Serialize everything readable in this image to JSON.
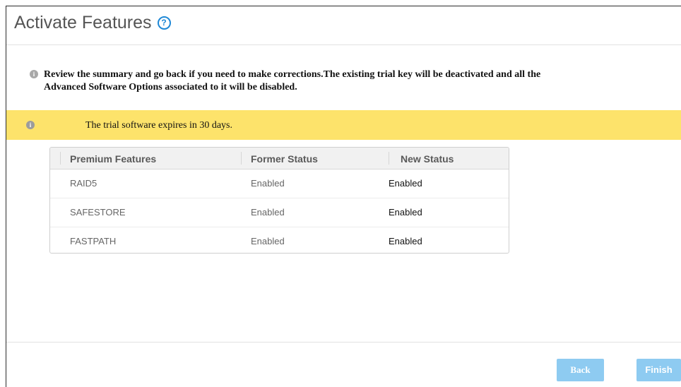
{
  "header": {
    "title": "Activate Features",
    "help_icon": "?"
  },
  "info_icon": "i",
  "review_message": {
    "line1": "Review the summary and go back if you need to make corrections.The existing trial key will be deactivated and all the",
    "line2": "Advanced Software Options associated to it will be disabled."
  },
  "banner": {
    "text": "The trial software expires in 30 days.",
    "color": "#fde36b"
  },
  "table": {
    "headers": [
      "Premium Features",
      "Former Status",
      "New Status"
    ],
    "rows": [
      [
        "RAID5",
        "Enabled",
        "Enabled"
      ],
      [
        "SAFESTORE",
        "Enabled",
        "Enabled"
      ],
      [
        "FASTPATH",
        "Enabled",
        "Enabled"
      ]
    ]
  },
  "footer": {
    "back_label": "Back",
    "finish_label": "Finish",
    "button_color": "#8ecbf1"
  }
}
